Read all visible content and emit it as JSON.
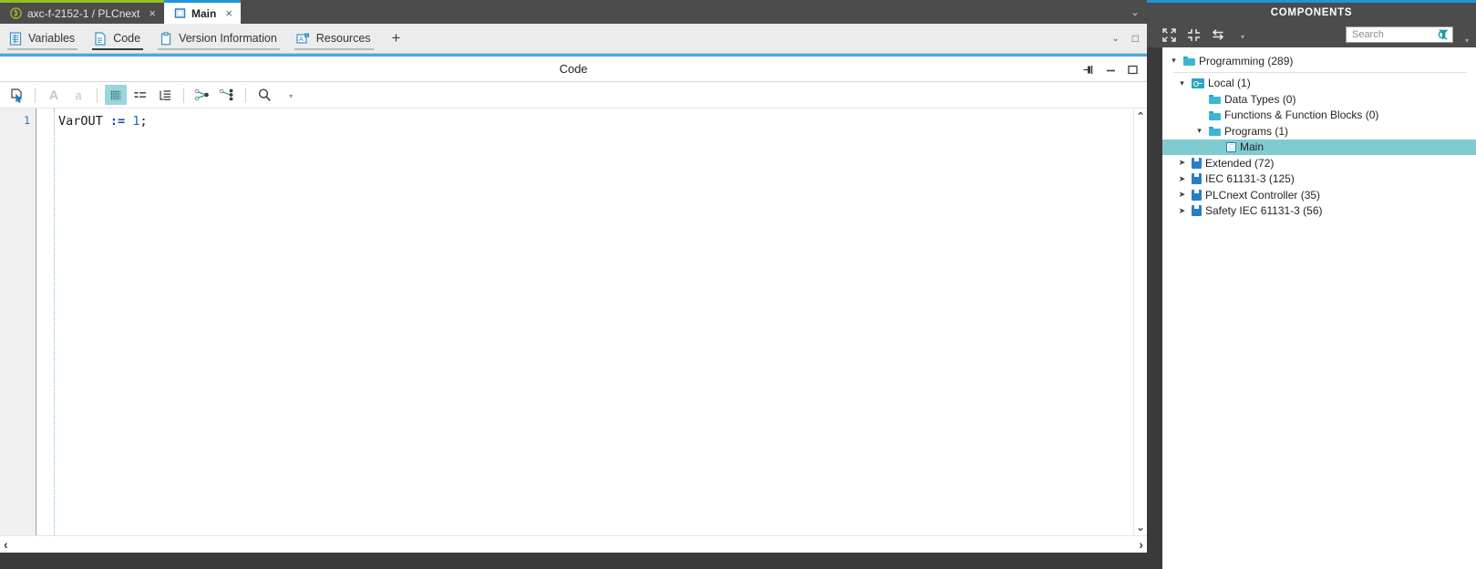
{
  "window_tabs": [
    {
      "label": "axc-f-2152-1 / PLCnext",
      "close": "×",
      "icon": "plcnext-project-icon",
      "active": false
    },
    {
      "label": "Main",
      "close": "×",
      "icon": "program-icon",
      "active": true
    }
  ],
  "window_tabs_overflow": "⌄",
  "sub_tabs": [
    {
      "label": "Variables",
      "icon": "variables-table-icon",
      "active": false
    },
    {
      "label": "Code",
      "icon": "code-document-icon",
      "active": true
    },
    {
      "label": "Version Information",
      "icon": "clipboard-icon",
      "active": false
    },
    {
      "label": "Resources",
      "icon": "resources-icon",
      "active": false
    }
  ],
  "sub_tabs_add_label": "+",
  "sub_tabs_right": {
    "chevron_down": "⌄",
    "maximize": "□"
  },
  "panel": {
    "title": "Code",
    "controls": [
      {
        "name": "pin-icon",
        "glyph": "⇥"
      },
      {
        "name": "minimize-icon",
        "glyph": "−"
      },
      {
        "name": "maximize-icon",
        "glyph": "□"
      }
    ]
  },
  "editor_toolbar": [
    {
      "name": "select-pointer-icon",
      "glyph": "⮚",
      "state": "normal"
    },
    {
      "name": "uppercase-A-icon",
      "glyph": "A",
      "state": "disabled"
    },
    {
      "name": "lowercase-a-icon",
      "glyph": "a",
      "state": "disabled"
    },
    {
      "name": "show-whitespace-icon",
      "glyph": "░",
      "state": "active"
    },
    {
      "name": "indent-guides-icon",
      "glyph": "≡",
      "state": "normal"
    },
    {
      "name": "outline-icon",
      "glyph": "≣",
      "state": "normal"
    },
    {
      "name": "expand-nodes-icon",
      "glyph": "⚷",
      "state": "normal"
    },
    {
      "name": "collapse-nodes-icon",
      "glyph": "⚸",
      "state": "normal"
    },
    {
      "name": "search-icon",
      "glyph": "⌕",
      "state": "normal"
    },
    {
      "name": "overflow-caret-icon",
      "glyph": "▾",
      "state": "caret"
    }
  ],
  "editor": {
    "lines": [
      {
        "number": "1",
        "tokens": [
          {
            "text": "VarOUT",
            "type": "var"
          },
          {
            "text": " ",
            "type": "pn"
          },
          {
            "text": ":=",
            "type": "op"
          },
          {
            "text": " ",
            "type": "pn"
          },
          {
            "text": "1",
            "type": "num"
          },
          {
            "text": ";",
            "type": "pn"
          }
        ]
      }
    ],
    "vscroll": {
      "up": "⌃",
      "down": "⌄"
    },
    "hscroll": {
      "left": "‹",
      "right": "›"
    }
  },
  "components": {
    "title": "COMPONENTS",
    "toolbar": [
      {
        "name": "expand-all-icon",
        "glyph": "⤡"
      },
      {
        "name": "collapse-all-icon",
        "glyph": "⤢"
      },
      {
        "name": "sync-selection-icon",
        "glyph": "⇆"
      },
      {
        "name": "toolbar-overflow-caret-icon",
        "glyph": "▾"
      }
    ],
    "search": {
      "placeholder": "Search",
      "value": "",
      "icon": "search-filter-icon"
    },
    "overflow_caret": "▾",
    "tree": [
      {
        "label": "Programming (289)",
        "indent": 0,
        "twisty": "expanded",
        "icon": "folder",
        "selected": false,
        "separator_after": true
      },
      {
        "label": "Local (1)",
        "indent": 1,
        "twisty": "expanded",
        "icon": "local",
        "selected": false
      },
      {
        "label": "Data Types (0)",
        "indent": 2,
        "twisty": "none",
        "icon": "folder",
        "selected": false
      },
      {
        "label": "Functions & Function Blocks (0)",
        "indent": 2,
        "twisty": "none",
        "icon": "folder",
        "selected": false
      },
      {
        "label": "Programs (1)",
        "indent": 2,
        "twisty": "expanded",
        "icon": "folder",
        "selected": false
      },
      {
        "label": "Main",
        "indent": 3,
        "twisty": "none",
        "icon": "program",
        "selected": true
      },
      {
        "label": "Extended (72)",
        "indent": 1,
        "twisty": "collapsed",
        "icon": "lib",
        "selected": false
      },
      {
        "label": "IEC 61131-3 (125)",
        "indent": 1,
        "twisty": "collapsed",
        "icon": "lib",
        "selected": false
      },
      {
        "label": "PLCnext Controller (35)",
        "indent": 1,
        "twisty": "collapsed",
        "icon": "lib",
        "selected": false
      },
      {
        "label": "Safety IEC 61131-3 (56)",
        "indent": 1,
        "twisty": "collapsed",
        "icon": "lib",
        "selected": false
      }
    ]
  },
  "colors": {
    "accent_blue": "#2196d4",
    "project_green": "#92c022",
    "selection_teal": "#7fcbd1",
    "panel_dark": "#4c4c4c",
    "toolbar_active": "#9ad6dd"
  }
}
